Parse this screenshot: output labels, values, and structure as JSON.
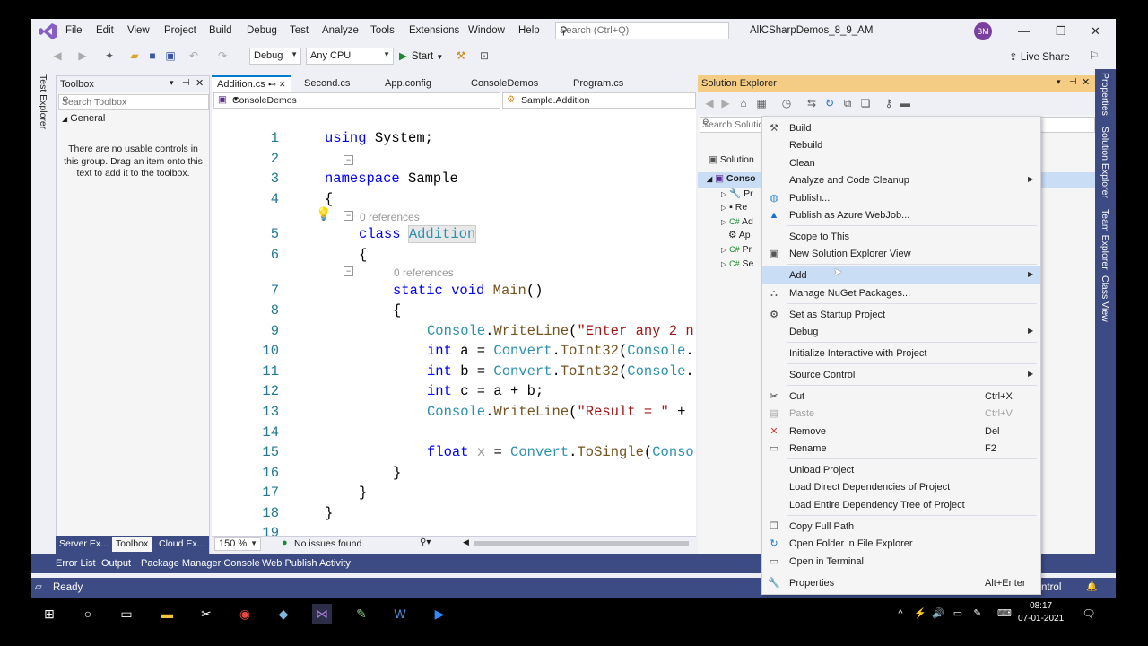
{
  "menu": {
    "items": [
      "File",
      "Edit",
      "View",
      "Project",
      "Build",
      "Debug",
      "Test",
      "Analyze",
      "Tools",
      "Extensions",
      "Window",
      "Help"
    ],
    "search_placeholder": "Search (Ctrl+Q)",
    "solution_name": "AllCSharpDemos_8_9_AM",
    "avatar_initials": "BM"
  },
  "toolbar": {
    "config": "Debug",
    "platform": "Any CPU",
    "start_label": "Start",
    "live_share": "Live Share"
  },
  "left_strip": {
    "label": "Test Explorer"
  },
  "right_strip": {
    "labels": [
      "Properties",
      "Solution Explorer",
      "Team Explorer",
      "Class View"
    ]
  },
  "toolbox": {
    "title": "Toolbox",
    "search_placeholder": "Search Toolbox",
    "group": "General",
    "message": "There are no usable controls in this group. Drag an item onto this text to add it to the toolbox.",
    "tabs": [
      "Server Ex...",
      "Toolbox",
      "Cloud Ex..."
    ]
  },
  "editor": {
    "tabs": [
      "Addition.cs",
      "Second.cs",
      "App.config",
      "ConsoleDemos",
      "Program.cs"
    ],
    "nav_left": "ConsoleDemos",
    "nav_right": "Sample.Addition",
    "references_label": "0 references",
    "line_numbers": [
      "1",
      "2",
      "3",
      "4",
      "5",
      "6",
      "7",
      "8",
      "9",
      "10",
      "11",
      "12",
      "13",
      "14",
      "15",
      "16",
      "17",
      "18",
      "19"
    ],
    "zoom": "150 %",
    "issues": "No issues found"
  },
  "solution_explorer": {
    "title": "Solution Explorer",
    "search_placeholder": "Search Solutio",
    "tree": [
      "Solution",
      "Conso",
      "Pr",
      "Re",
      "Ad",
      "Ap",
      "Pr",
      "Se"
    ]
  },
  "context_menu": {
    "items": [
      {
        "label": "Build",
        "icon": "build-icon",
        "shortcut": "",
        "submenu": false,
        "disabled": false
      },
      {
        "label": "Rebuild",
        "icon": "",
        "shortcut": "",
        "submenu": false,
        "disabled": false
      },
      {
        "label": "Clean",
        "icon": "",
        "shortcut": "",
        "submenu": false,
        "disabled": false
      },
      {
        "label": "Analyze and Code Cleanup",
        "icon": "",
        "shortcut": "",
        "submenu": true,
        "disabled": false
      },
      {
        "label": "Publish...",
        "icon": "globe-icon",
        "shortcut": "",
        "submenu": false,
        "disabled": false
      },
      {
        "label": "Publish as Azure WebJob...",
        "icon": "azure-icon",
        "shortcut": "",
        "submenu": false,
        "disabled": false
      },
      {
        "label": "Scope to This",
        "icon": "",
        "shortcut": "",
        "submenu": false,
        "disabled": false
      },
      {
        "label": "New Solution Explorer View",
        "icon": "new-view-icon",
        "shortcut": "",
        "submenu": false,
        "disabled": false
      },
      {
        "label": "Add",
        "icon": "",
        "shortcut": "",
        "submenu": true,
        "disabled": false,
        "highlighted": true
      },
      {
        "label": "Manage NuGet Packages...",
        "icon": "nuget-icon",
        "shortcut": "",
        "submenu": false,
        "disabled": false
      },
      {
        "label": "Set as Startup Project",
        "icon": "gear-icon",
        "shortcut": "",
        "submenu": false,
        "disabled": false
      },
      {
        "label": "Debug",
        "icon": "",
        "shortcut": "",
        "submenu": true,
        "disabled": false
      },
      {
        "label": "Initialize Interactive with Project",
        "icon": "",
        "shortcut": "",
        "submenu": false,
        "disabled": false
      },
      {
        "label": "Source Control",
        "icon": "",
        "shortcut": "",
        "submenu": true,
        "disabled": false
      },
      {
        "label": "Cut",
        "icon": "scissors-icon",
        "shortcut": "Ctrl+X",
        "submenu": false,
        "disabled": false
      },
      {
        "label": "Paste",
        "icon": "paste-icon",
        "shortcut": "Ctrl+V",
        "submenu": false,
        "disabled": true
      },
      {
        "label": "Remove",
        "icon": "remove-icon",
        "shortcut": "Del",
        "submenu": false,
        "disabled": false
      },
      {
        "label": "Rename",
        "icon": "rename-icon",
        "shortcut": "F2",
        "submenu": false,
        "disabled": false
      },
      {
        "label": "Unload Project",
        "icon": "",
        "shortcut": "",
        "submenu": false,
        "disabled": false
      },
      {
        "label": "Load Direct Dependencies of Project",
        "icon": "",
        "shortcut": "",
        "submenu": false,
        "disabled": false
      },
      {
        "label": "Load Entire Dependency Tree of Project",
        "icon": "",
        "shortcut": "",
        "submenu": false,
        "disabled": false
      },
      {
        "label": "Copy Full Path",
        "icon": "copy-icon",
        "shortcut": "",
        "submenu": false,
        "disabled": false
      },
      {
        "label": "Open Folder in File Explorer",
        "icon": "refresh-folder-icon",
        "shortcut": "",
        "submenu": false,
        "disabled": false
      },
      {
        "label": "Open in Terminal",
        "icon": "terminal-icon",
        "shortcut": "",
        "submenu": false,
        "disabled": false
      },
      {
        "label": "Properties",
        "icon": "wrench-icon",
        "shortcut": "Alt+Enter",
        "submenu": false,
        "disabled": false
      }
    ]
  },
  "bottom_tabs": [
    "Error List",
    "Output",
    "Package Manager Console",
    "Web Publish Activity"
  ],
  "status": {
    "text": "Ready",
    "right": "ntrol"
  },
  "clock": {
    "time": "08:17",
    "date": "07-01-2021"
  },
  "colors": {
    "accent": "#3c4b84",
    "highlight": "#c9def5",
    "solex_header": "#f5cc84"
  }
}
